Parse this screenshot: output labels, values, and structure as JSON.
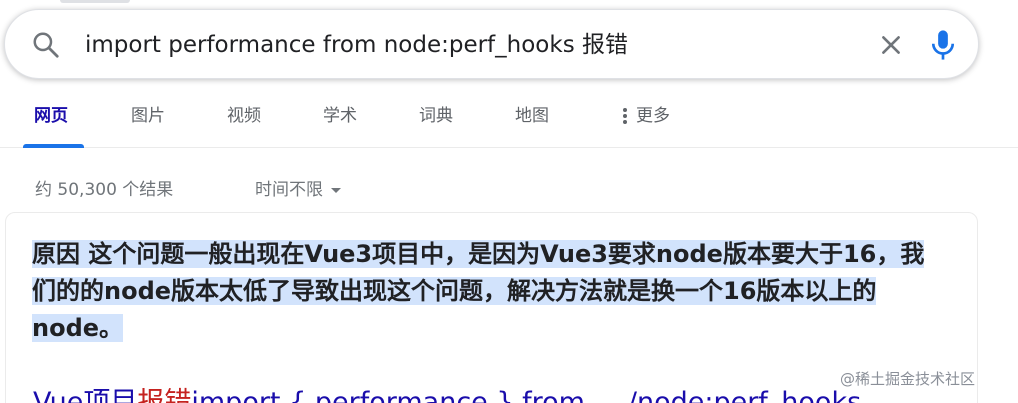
{
  "search": {
    "query": "import performance from node:perf_hooks 报错"
  },
  "tabs": [
    {
      "label": "网页",
      "active": true
    },
    {
      "label": "图片"
    },
    {
      "label": "视频"
    },
    {
      "label": "学术"
    },
    {
      "label": "词典"
    },
    {
      "label": "地图"
    },
    {
      "label": "更多"
    }
  ],
  "stats": {
    "result_count": "约 50,300 个结果",
    "time_filter": "时间不限"
  },
  "featured_snippet": {
    "text": "原因 这个问题一般出现在Vue3项目中，是因为Vue3要求node版本要大于16，我们的的node版本太低了导致出现这个问题，解决方法就是换一个16版本以上的node。"
  },
  "first_result": {
    "title_prefix": "Vue项目",
    "title_highlight": "报错",
    "title_rest": "import { performance } from ... /node:perf_hooks"
  },
  "watermark": "@稀土掘金技术社区",
  "colors": {
    "accent": "#1a73e8",
    "link": "#1a0dab",
    "highlight": "#d2e3fc"
  }
}
